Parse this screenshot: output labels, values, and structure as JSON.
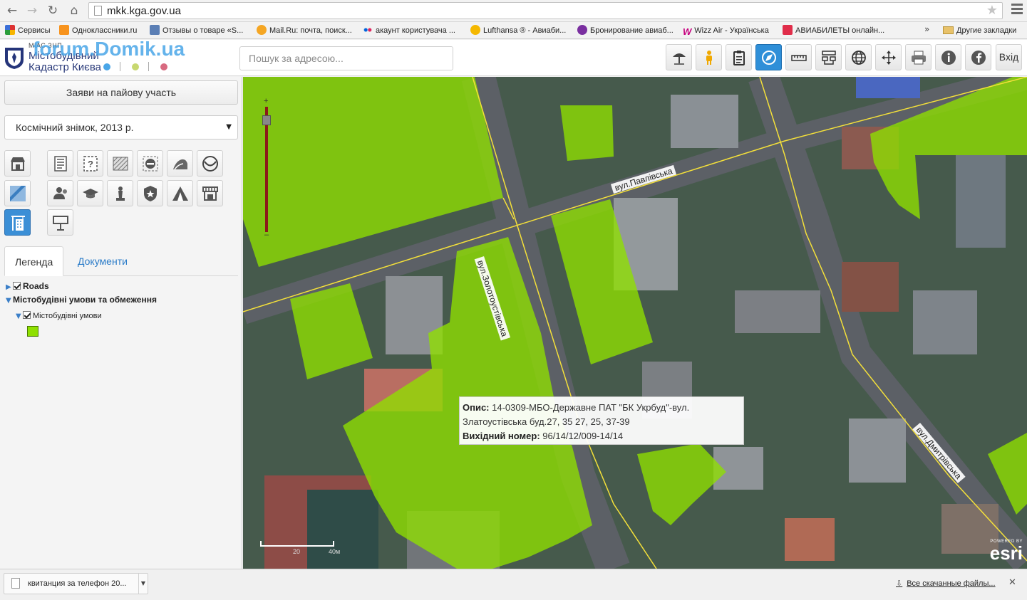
{
  "browser": {
    "url": "mkk.kga.gov.ua",
    "bookmarks": [
      {
        "label": "Сервисы",
        "icon": "apps-grid-icon",
        "color": "#d33"
      },
      {
        "label": "Одноклассники.ru",
        "icon": "odnoklassniki-icon",
        "color": "#f7931e"
      },
      {
        "label": "Отзывы о товаре «S...",
        "icon": "review-icon",
        "color": "#5b7fb5"
      },
      {
        "label": "Mail.Ru: почта, поиск...",
        "icon": "mailru-icon",
        "color": "#f5a623"
      },
      {
        "label": "акаунт користувача ...",
        "icon": "flickr-dots-icon",
        "color": "#e0245e"
      },
      {
        "label": "Lufthansa ® - Авиаби...",
        "icon": "lufthansa-icon",
        "color": "#f5b800"
      },
      {
        "label": "Бронирование авиаб...",
        "icon": "airline-icon",
        "color": "#7a2fa0"
      },
      {
        "label": "Wizz Air - Українська",
        "icon": "wizzair-icon",
        "color": "#c6007e"
      },
      {
        "label": "АВИАБИЛЕТЫ онлайн...",
        "icon": "aviasales-icon",
        "color": "#e02d4a"
      }
    ],
    "other_bookmarks": "Другие закладки",
    "more": "»"
  },
  "header": {
    "logo_small": "МІАС ЗНП",
    "logo_line1": "Містобудівний",
    "logo_line2": "Кадастр Києва",
    "watermark": "forum.Domik.ua",
    "search_placeholder": "Пошук за адресою...",
    "tools": [
      {
        "name": "weather-umbrella-tool",
        "icon": "umbrella-icon"
      },
      {
        "name": "street-view-tool",
        "icon": "pegman-icon"
      },
      {
        "name": "clipboard-tool",
        "icon": "clipboard-icon"
      },
      {
        "name": "navigation-tool",
        "icon": "compass-icon",
        "active": true
      },
      {
        "name": "measure-tool",
        "icon": "ruler-icon"
      },
      {
        "name": "layers-tool",
        "icon": "layer-tree-icon"
      },
      {
        "name": "globe-tool",
        "icon": "globe-icon"
      },
      {
        "name": "full-extent-tool",
        "icon": "move-arrows-icon"
      },
      {
        "name": "print-tool",
        "icon": "printer-icon"
      },
      {
        "name": "info-tool",
        "icon": "info-icon"
      },
      {
        "name": "facebook-tool",
        "icon": "facebook-icon"
      }
    ],
    "login_label": "Вхід"
  },
  "sidebar": {
    "apply_button": "Заяви на пайову участь",
    "basemap_selected": "Космічний знімок, 2013 р.",
    "layer_buttons_row1": [
      "shop-icon",
      "document-lines-icon",
      "question-document-icon",
      "hatched-map-icon",
      "no-entry-icon",
      "landslide-icon",
      "leaf-circle-icon"
    ],
    "layer_buttons_row2": [
      "map-water-icon",
      "people-icon",
      "graduation-cap-icon",
      "monument-icon",
      "police-badge-icon",
      "tent-icon",
      "market-stall-icon"
    ],
    "layer_buttons_row3": [
      "building-crane-icon",
      "billboard-icon"
    ],
    "tabs": {
      "legend": "Легенда",
      "documents": "Документи"
    },
    "legend": {
      "roads": "Roads",
      "group": "Містобудівні умови та обмеження",
      "layer": "Містобудівні умови",
      "swatch_color": "#8fe000"
    }
  },
  "map": {
    "streets": {
      "pavlivska": "вул.Павлівська",
      "zolotoustivska": "вул.Золотоустівська",
      "dmytrivska": "вул.Дмитрівська"
    },
    "popup": {
      "desc_label": "Опис:",
      "desc_value": "14-0309-МБО-Державне ПАТ \"БК Укрбуд\"-вул.",
      "desc_line2": "Златоустівська буд.27, 35 27, 25, 37-39",
      "out_label": "Вихідний номер:",
      "out_value": "96/14/12/009-14/14"
    },
    "scale_labels": [
      "20",
      "40м"
    ],
    "esri_powered": "POWERED BY",
    "esri_logo": "esri",
    "overlay_color": "#8fe000"
  },
  "downloads": {
    "file_name": "квитанция за телефон 20...",
    "all_downloads": "Все скачанные файлы...",
    "close": "✕"
  }
}
